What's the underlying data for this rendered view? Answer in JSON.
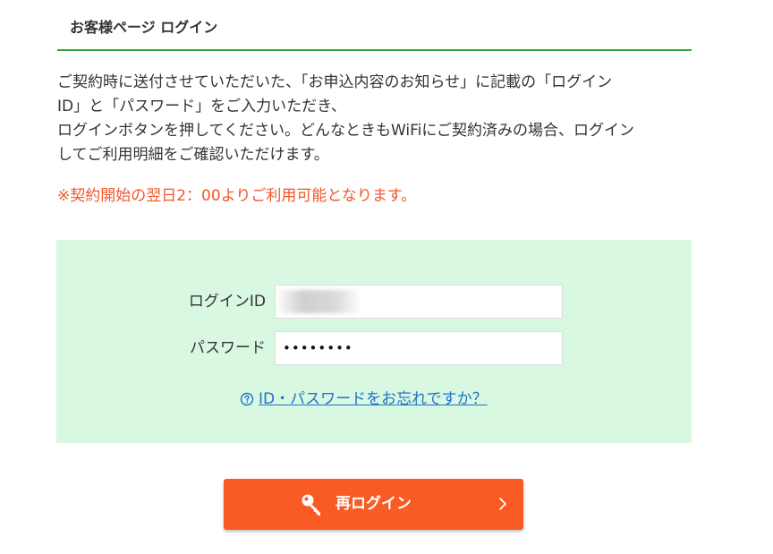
{
  "header": {
    "title": "お客様ページ ログイン"
  },
  "intro": {
    "lines": [
      "ご契約時に送付させていただいた、「お申込内容のお知らせ」に記載の「ログイン",
      "ID」と「パスワード」をご入力いただき、",
      "ログインボタンを押してください。どんなときもWiFiにご契約済みの場合、ログイン",
      "してご利用明細をご確認いただけます。"
    ],
    "notice": "※契約開始の翌日2：00よりご利用可能となります。"
  },
  "form": {
    "login_id_label": "ログインID",
    "login_id_value": "",
    "password_label": "パスワード",
    "password_value": "••••••••",
    "forgot_link": "ID・パスワードをお忘れですか？"
  },
  "login_button": {
    "label": "再ログイン"
  },
  "colors": {
    "accent_green": "#2da53a",
    "panel_bg": "#d8f8e2",
    "notice_red": "#f2562a",
    "link_blue": "#1f73c6",
    "button_orange": "#fa5a23"
  },
  "icons": {
    "help": "question-circle-icon",
    "key": "key-icon",
    "chevron": "chevron-right-icon"
  }
}
